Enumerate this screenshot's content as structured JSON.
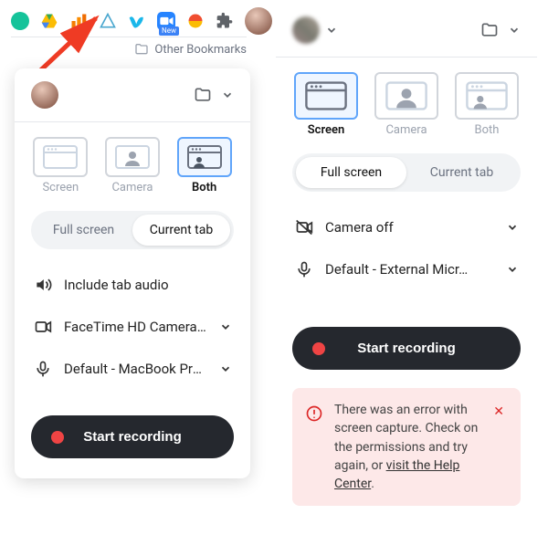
{
  "toolbar": {
    "icons": [
      "grammarly",
      "drive",
      "analytics",
      "asana",
      "vimeo",
      "video-chat",
      "loom",
      "extensions",
      "avatar"
    ],
    "new_badge": "New",
    "other_bookmarks": "Other Bookmarks"
  },
  "left_popup": {
    "modes": [
      {
        "id": "screen",
        "label": "Screen",
        "selected": false
      },
      {
        "id": "camera",
        "label": "Camera",
        "selected": false
      },
      {
        "id": "both",
        "label": "Both",
        "selected": true
      }
    ],
    "segments": {
      "full": "Full screen",
      "tab": "Current tab",
      "active": "tab"
    },
    "opts": {
      "audio": "Include tab audio",
      "camera": "FaceTime HD Camera (...",
      "mic": "Default - MacBook Pro ..."
    },
    "start": "Start recording"
  },
  "right_popup": {
    "modes": [
      {
        "id": "screen",
        "label": "Screen",
        "selected": true
      },
      {
        "id": "camera",
        "label": "Camera",
        "selected": false
      },
      {
        "id": "both",
        "label": "Both",
        "selected": false
      }
    ],
    "segments": {
      "full": "Full screen",
      "tab": "Current tab",
      "active": "full"
    },
    "opts": {
      "camera": "Camera off",
      "mic": "Default - External Micr…"
    },
    "start": "Start recording",
    "error": {
      "pre": "There was an error with screen capture. Check on the permissions and try again, or ",
      "link": "visit the Help Center",
      "post": "."
    }
  }
}
